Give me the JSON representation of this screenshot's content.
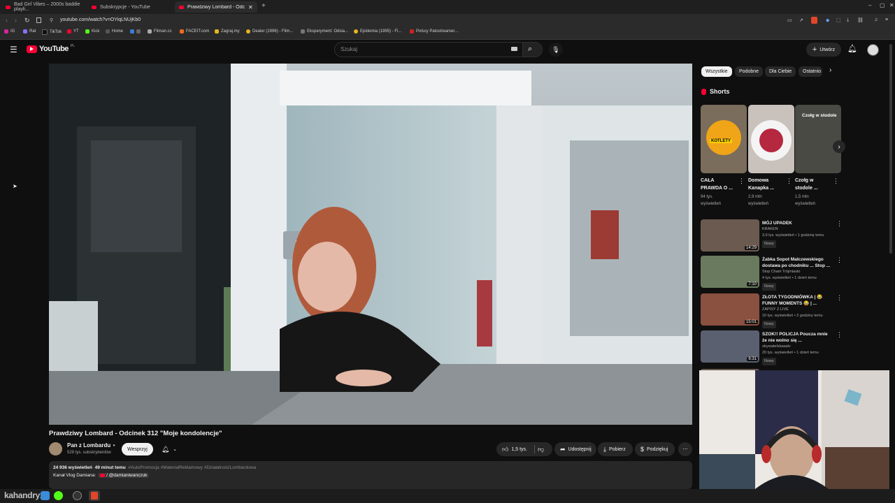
{
  "browser": {
    "tabs": [
      {
        "title": "Bad Girl Vibes – 2000s baddie playli...",
        "active": false
      },
      {
        "title": "Subskrypcje - YouTube",
        "active": false
      },
      {
        "title": "Prawdziwy Lombard - Odcin...",
        "active": true
      }
    ],
    "url": "youtube.com/watch?v=OYiqLNUjKb0",
    "bookmarks": [
      "IG",
      "Rat",
      "TikTok",
      "YT",
      "Kick",
      "Home",
      "Filman.cc",
      "FACEIT.com",
      "Zagraj.my",
      "Dealer (1996) - Film...",
      "Eksperyment: Odsia...",
      "Epidemia (1995) - Fi...",
      "Polscy Patostreamer..."
    ]
  },
  "header": {
    "logo_text": "YouTube",
    "logo_sup": "PL",
    "search_placeholder": "Szukaj",
    "create_label": "Utwórz"
  },
  "video": {
    "title": "Prawdziwy Lombard - Odcinek 312 \"Moje kondolencje\"",
    "channel": "Pan z Lombardu",
    "subscribers": "529 tys. subskrybentów",
    "support_label": "Wesprzyj",
    "likes": "1,5 tys.",
    "share_label": "Udostępnij",
    "download_label": "Pobierz",
    "thanks_label": "Podziękuj",
    "views": "24 936 wyświetleń",
    "age": "49 minut temu",
    "hashtags": "#AutoPromocja #MaterialReklamowy #DziałalnośćLombardowa",
    "desc_line": "Kanał Vlog Damiana:",
    "desc_link": "/ @damianiwanczuk"
  },
  "chips": [
    "Wszystkie",
    "Podobne",
    "Dla Ciebie",
    "Ostatnio"
  ],
  "shorts": {
    "heading": "Shorts",
    "items": [
      {
        "title1": "CAŁA",
        "title2": "PRAWDA O ...",
        "views1": "94 tys.",
        "views2": "wyświetleń",
        "overlay": "KOTLETY",
        "bg": "#7a6d5c"
      },
      {
        "title1": "Domowa",
        "title2": "Kanapka ...",
        "views1": "2,9 mln",
        "views2": "wyświetleń",
        "overlay": "",
        "bg": "#c9c1bb"
      },
      {
        "title1": "Czołg w",
        "title2": "stodole ...",
        "views1": "1,5 mln",
        "views2": "wyświetleń",
        "overlay": "Czołg w stodole",
        "bg": "#4a4a45"
      }
    ]
  },
  "related": [
    {
      "title1": "MÓJ UPADEK",
      "title2": "",
      "channel": "KRAKEN",
      "meta": "3,9 tys. wyświetleń • 1 godzinę temu",
      "badge": "Nowy",
      "duration": "14:29",
      "bg": "#6b5a50"
    },
    {
      "title1": "Żabka Sopot Malczewskiego",
      "title2": "dostawa po chodniku ... Stop ...",
      "channel": "Stop Cham Trójmiasto",
      "meta": "4 tys. wyświetleń • 1 dzień temu",
      "badge": "Nowy",
      "duration": "7:10",
      "bg": "#6a7a5e"
    },
    {
      "title1": "ZŁOTA TYGODNIÓWKA | 😂",
      "title2": "FUNNY MOMENTS 😂 | ...",
      "channel": "ZAPISY Z LIVE",
      "meta": "10 tys. wyświetleń • 2 godziny temu",
      "badge": "Nowy",
      "duration": "15:01",
      "bg": "#8a5040"
    },
    {
      "title1": "SZOK!! POLICJA Poucza mnie",
      "title2": "że nie wolno się ...",
      "channel": "obywatelskaaatv",
      "meta": "20 tys. wyświetleń • 1 dzień temu",
      "badge": "Nowy",
      "duration": "6:31",
      "bg": "#5a6070"
    }
  ],
  "taskbar": {
    "watermark": "kahandryx"
  }
}
